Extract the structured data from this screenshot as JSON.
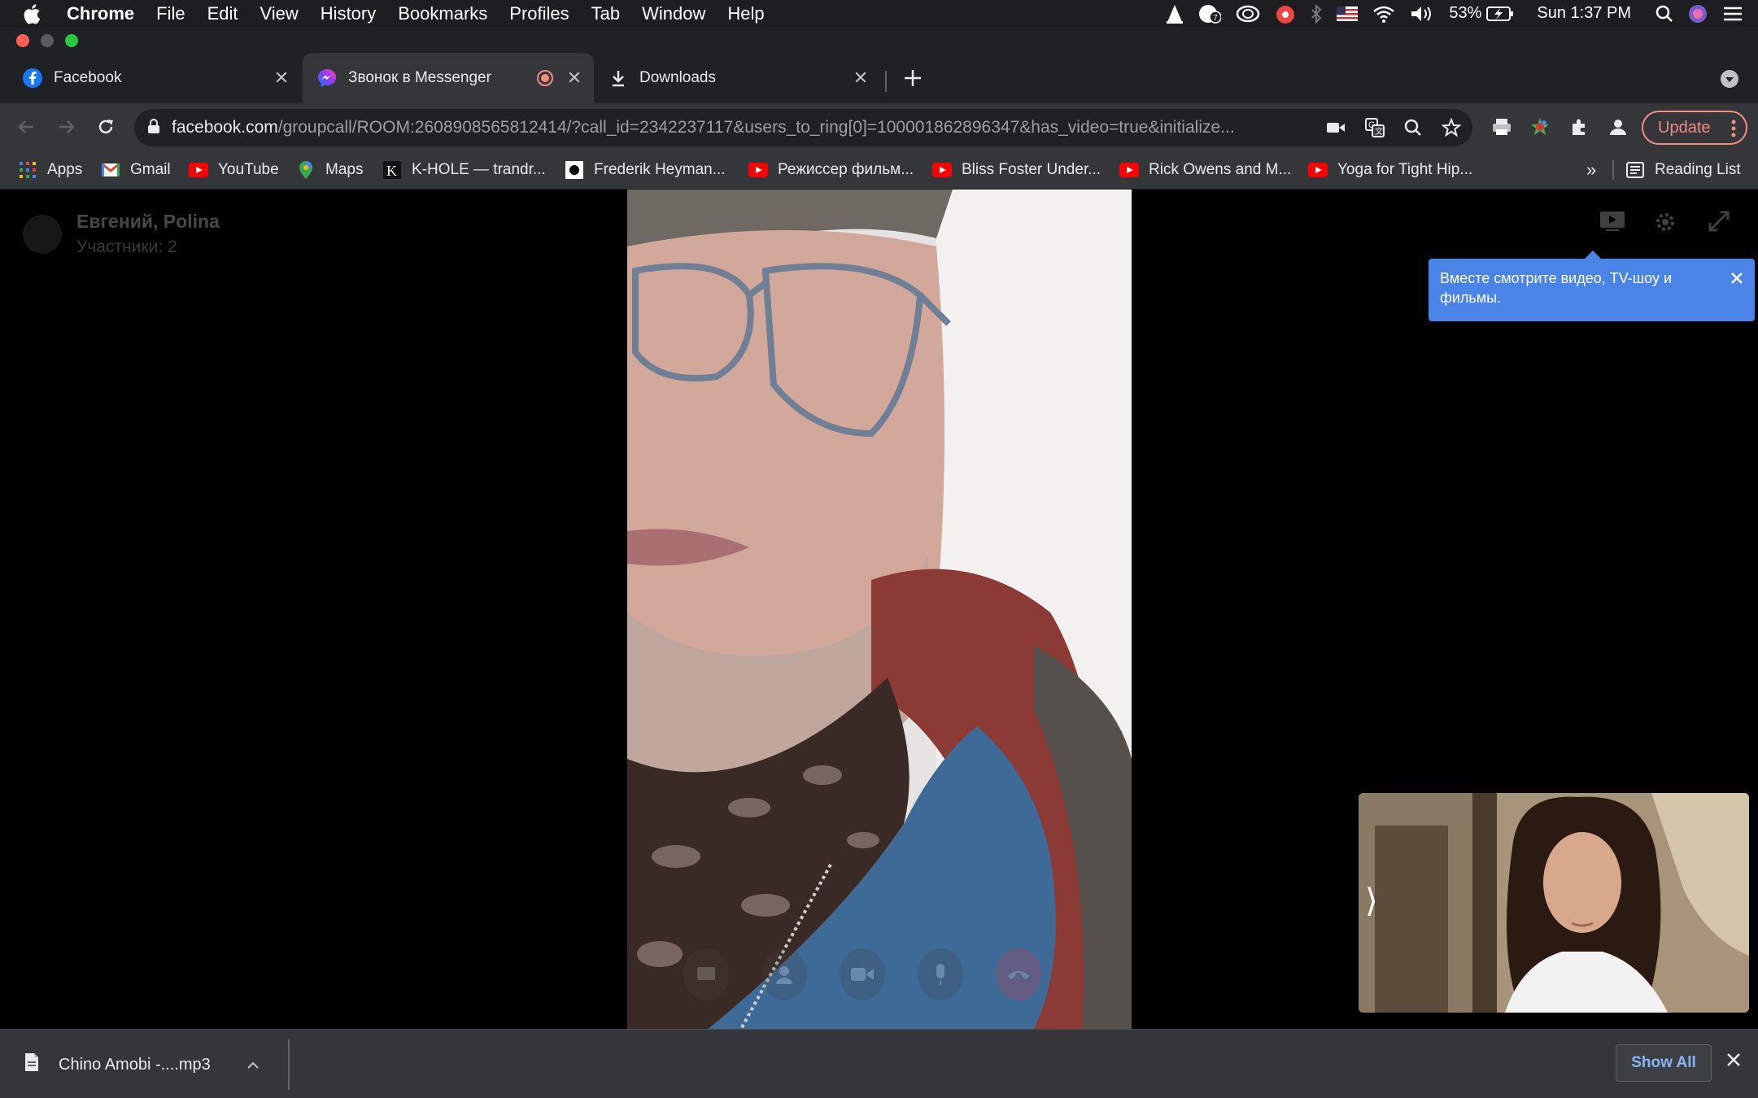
{
  "menubar": {
    "app_name": "Chrome",
    "items": [
      "File",
      "Edit",
      "View",
      "History",
      "Bookmarks",
      "Profiles",
      "Tab",
      "Window",
      "Help"
    ],
    "battery": "53%",
    "clock": "Sun 1:37 PM",
    "notification_badge": "7"
  },
  "tabs": [
    {
      "title": "Facebook",
      "icon": "facebook-icon"
    },
    {
      "title": "Звонок в Messenger",
      "icon": "messenger-icon",
      "active": true,
      "recording": true
    },
    {
      "title": "Downloads",
      "icon": "download-icon"
    }
  ],
  "omnibox": {
    "host": "facebook.com",
    "path": "/groupcall/ROOM:2608908565812414/?call_id=2342237117&users_to_ring[0]=100001862896347&has_video=true&initialize..."
  },
  "toolbar": {
    "update_label": "Update"
  },
  "bookmarks": {
    "items": [
      {
        "label": "Apps",
        "icon": "apps-grid-icon"
      },
      {
        "label": "Gmail",
        "icon": "gmail-icon"
      },
      {
        "label": "YouTube",
        "icon": "youtube-icon"
      },
      {
        "label": "Maps",
        "icon": "maps-pin-icon"
      },
      {
        "label": "K-HOLE — trandr...",
        "icon": "k-hole-icon"
      },
      {
        "label": "Frederik Heyman...",
        "icon": "dot-icon"
      },
      {
        "label": "Режиссер фильм...",
        "icon": "youtube-icon"
      },
      {
        "label": "Bliss Foster Under...",
        "icon": "youtube-icon"
      },
      {
        "label": "Rick Owens and M...",
        "icon": "youtube-icon"
      },
      {
        "label": "Yoga for Tight Hip...",
        "icon": "youtube-icon"
      }
    ],
    "overflow": "»",
    "reading_list": "Reading List"
  },
  "call": {
    "participants_names": "Евгений, Polina",
    "participants_count": "Участники: 2",
    "tooltip": "Вместе смотрите видео, TV-шоу и фильмы."
  },
  "download_shelf": {
    "file_name": "Chino Amobi -....mp3",
    "show_all": "Show All"
  },
  "colors": {
    "facebook_blue": "#1877f2",
    "tooltip_blue": "#4a84e6",
    "update_red": "#f28b82",
    "youtube_red": "#ff0000"
  }
}
